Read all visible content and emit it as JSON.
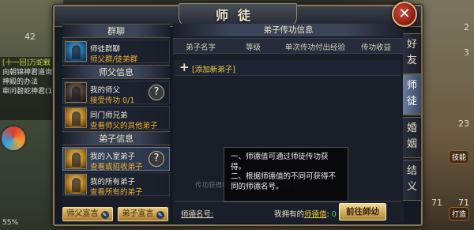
{
  "background": {
    "chat_lines": [
      {
        "text": "[十一回]万蛇戰",
        "highlight": true
      },
      {
        "text": "向朝锦神君道询问",
        "highlight": false
      },
      {
        "text": "神殿的办法",
        "highlight": false
      },
      {
        "text": "审问碧蛇神君(1",
        "highlight": false
      }
    ],
    "level_number": "42",
    "right_numbers": [
      "2",
      "3",
      "23",
      "71",
      "71"
    ],
    "right_labels": [
      "技能",
      "打造"
    ],
    "status_text": "55%"
  },
  "window": {
    "title": "师徒",
    "close_label": "✕"
  },
  "left": {
    "sections": [
      {
        "header": "群聊",
        "entries": [
          {
            "name": "师徒群聊",
            "sub": "师父群/徒弟群",
            "icon": "group-chat-icon",
            "style": "blue",
            "selected": false,
            "help": false
          }
        ]
      },
      {
        "header": "师父信息",
        "entries": [
          {
            "name": "我的师父",
            "sub": "接受传功 0/1",
            "icon": "master-portrait-icon",
            "style": "dark",
            "selected": false,
            "help": true
          },
          {
            "name": "同门师兄弟",
            "sub": "查看师父的其他弟子",
            "icon": "fellow-disciples-icon",
            "style": "gold",
            "selected": false,
            "help": false
          }
        ]
      },
      {
        "header": "弟子信息",
        "entries": [
          {
            "name": "我的入室弟子",
            "sub": "查看或招收弟子",
            "icon": "disciple-portrait-icon",
            "style": "gold",
            "selected": true,
            "help": true
          },
          {
            "name": "我的所有弟子",
            "sub": "查看所有的弟子",
            "icon": "all-disciples-icon",
            "style": "gold",
            "selected": false,
            "help": false
          }
        ]
      }
    ],
    "buttons": {
      "master_decl": "师父宣言",
      "disciple_decl": "弟子宣言"
    }
  },
  "right": {
    "header": "弟子传功信息",
    "columns": [
      "弟子名字",
      "等级",
      "单次传功付出经验",
      "传功收益"
    ],
    "add_link": "[添加新弟子]",
    "faded_text": "传功获得经验 0/4  累计传功次数 0",
    "tooltip": {
      "line1": "一、师德值可通过师徒传功获得。",
      "line2": "二、根据师德值的不同可获得不同的师德名号。"
    },
    "footer": {
      "label": "师德名号:",
      "own_prefix": "我拥有的",
      "own_link": "师德值",
      "own_colon": ":",
      "own_value": "0",
      "goto_button": "前往師幼"
    }
  },
  "tabs": [
    {
      "label": "好友",
      "active": false
    },
    {
      "label": "师徒",
      "active": true
    },
    {
      "label": "婚姻",
      "active": false
    },
    {
      "label": "结义",
      "active": false
    }
  ]
}
